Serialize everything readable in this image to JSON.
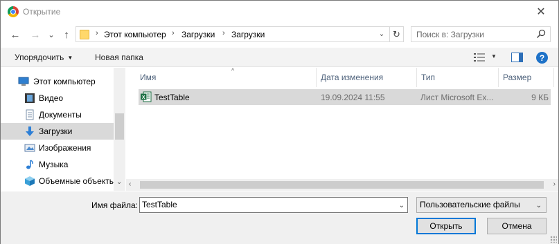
{
  "window": {
    "title": "Открытие",
    "close_symbol": "✕"
  },
  "navigation": {
    "back_symbol": "←",
    "forward_symbol": "→",
    "recent_symbol": "⌄",
    "up_symbol": "↑",
    "breadcrumbs": [
      "Этот компьютер",
      "Загрузки",
      "Загрузки"
    ],
    "refresh_symbol": "↻"
  },
  "search": {
    "placeholder": "Поиск в: Загрузки"
  },
  "toolbar": {
    "organize_label": "Упорядочить",
    "new_folder_label": "Новая папка",
    "help_symbol": "?"
  },
  "sidebar": {
    "items": [
      {
        "label": "Этот компьютер",
        "icon": "computer-icon"
      },
      {
        "label": "Видео",
        "icon": "video-icon"
      },
      {
        "label": "Документы",
        "icon": "documents-icon"
      },
      {
        "label": "Загрузки",
        "icon": "downloads-icon",
        "selected": true
      },
      {
        "label": "Изображения",
        "icon": "pictures-icon"
      },
      {
        "label": "Музыка",
        "icon": "music-icon"
      },
      {
        "label": "Объемные объекть",
        "icon": "3d-objects-icon"
      }
    ]
  },
  "file_list": {
    "columns": [
      "Имя",
      "Дата изменения",
      "Тип",
      "Размер"
    ],
    "rows": [
      {
        "name": "TestTable",
        "modified": "19.09.2024 11:55",
        "type": "Лист Microsoft Ex...",
        "size": "9 КБ",
        "icon": "excel-file-icon"
      }
    ]
  },
  "footer": {
    "filename_label": "Имя файла:",
    "filename_value": "TestTable",
    "filetype_value": "Пользовательские файлы",
    "open_label": "Открыть",
    "cancel_label": "Отмена"
  },
  "colors": {
    "selection": "#d9d9d9",
    "toolbar_bg": "#f3f3f3",
    "accent_blue": "#0078d7",
    "header_text": "#4c607a"
  }
}
